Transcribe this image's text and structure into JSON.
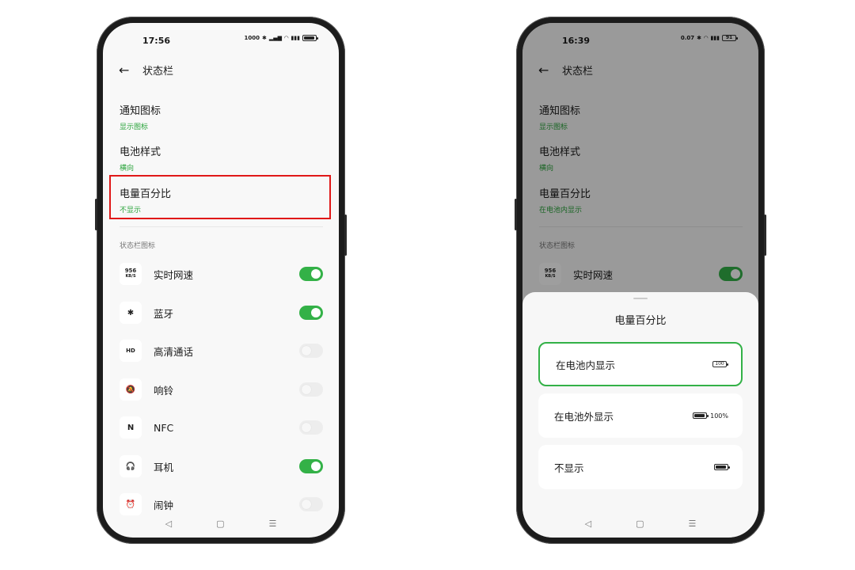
{
  "left_phone": {
    "time": "17:56",
    "net_rate": "1000",
    "title": "状态栏",
    "settings": [
      {
        "title": "通知图标",
        "value": "显示图标"
      },
      {
        "title": "电池样式",
        "value": "横向"
      },
      {
        "title": "电量百分比",
        "value": "不显示"
      }
    ],
    "section_label": "状态栏图标",
    "icon_rows": [
      {
        "icon": "speed-icon",
        "badge_top": "956",
        "badge_bottom": "KB/S",
        "label": "实时网速",
        "on": true
      },
      {
        "icon": "bluetooth-icon",
        "glyph": "✱",
        "label": "蓝牙",
        "on": true
      },
      {
        "icon": "hd-call-icon",
        "glyph": "HD",
        "label": "高清通话",
        "on": false
      },
      {
        "icon": "ringer-off-icon",
        "glyph": "🔕",
        "label": "响铃",
        "on": false
      },
      {
        "icon": "nfc-icon",
        "glyph": "N",
        "label": "NFC",
        "on": false
      },
      {
        "icon": "headphones-icon",
        "glyph": "🎧",
        "label": "耳机",
        "on": true
      },
      {
        "icon": "alarm-icon",
        "glyph": "⏰",
        "label": "闹钟",
        "on": false
      }
    ]
  },
  "right_phone": {
    "time": "16:39",
    "net_rate": "0.07",
    "battery_text": "91",
    "title": "状态栏",
    "settings": [
      {
        "title": "通知图标",
        "value": "显示图标"
      },
      {
        "title": "电池样式",
        "value": "横向"
      },
      {
        "title": "电量百分比",
        "value": "在电池内显示"
      }
    ],
    "section_label": "状态栏图标",
    "icon_row": {
      "badge_top": "956",
      "badge_bottom": "KB/S",
      "label": "实时网速"
    },
    "sheet": {
      "title": "电量百分比",
      "options": [
        {
          "label": "在电池内显示",
          "battery_text": "100",
          "selected": true
        },
        {
          "label": "在电池外显示",
          "pct": "100%"
        },
        {
          "label": "不显示"
        }
      ]
    }
  },
  "nav": {
    "back": "◁",
    "home": "▢",
    "recent": "☰"
  },
  "colors": {
    "accent": "#33b147",
    "highlight": "#e01818"
  }
}
